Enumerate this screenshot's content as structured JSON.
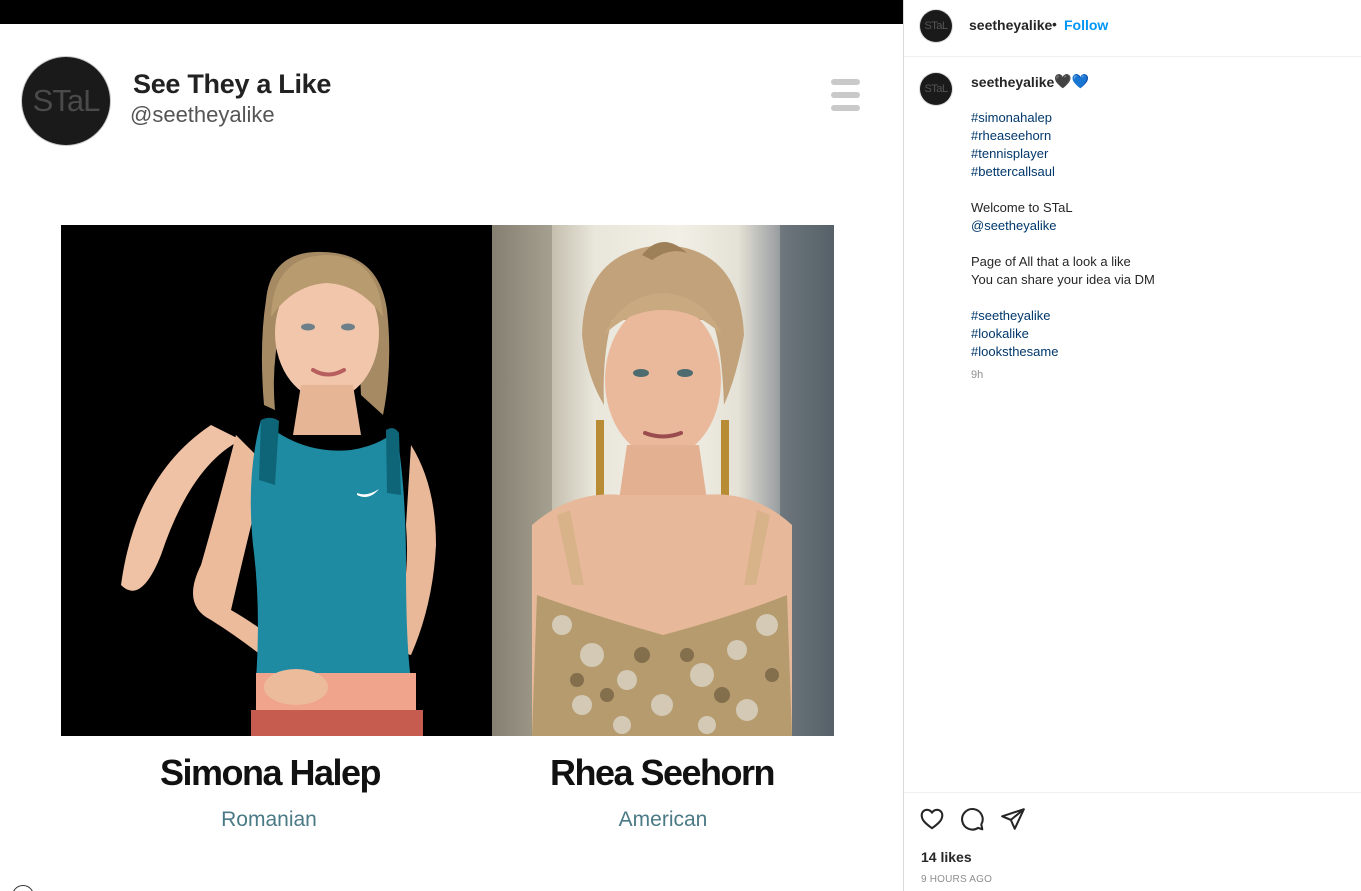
{
  "card": {
    "avatar_text": "STaL",
    "title": "See They a Like",
    "handle": "@seetheyalike"
  },
  "people": [
    {
      "name": "Simona Halep",
      "nationality": "Romanian"
    },
    {
      "name": "Rhea Seehorn",
      "nationality": "American"
    }
  ],
  "header": {
    "avatar_text": "STaL",
    "username": "seetheyalike",
    "separator": "•",
    "follow_label": "Follow"
  },
  "caption": {
    "avatar_text": "STaL",
    "username": "seetheyalike",
    "heart1": "🖤",
    "heart2": "💙",
    "lines": [
      "#simonahalep",
      "#rheaseehorn",
      "#tennisplayer",
      "#bettercallsaul",
      "",
      "Welcome to STaL",
      "@seetheyalike",
      "",
      "Page of All that a look a like",
      "You can share your idea via DM",
      "",
      "#seetheyalike",
      "#lookalike",
      "#looksthesame"
    ],
    "time": "9h"
  },
  "actions": {
    "icons": [
      "heart-icon",
      "comment-icon",
      "share-icon"
    ]
  },
  "likes": "14 likes",
  "post_age": "9 HOURS AGO",
  "colors": {
    "follow": "#0095f6",
    "hashtag": "#00376b",
    "nationality": "#4a7a85"
  }
}
